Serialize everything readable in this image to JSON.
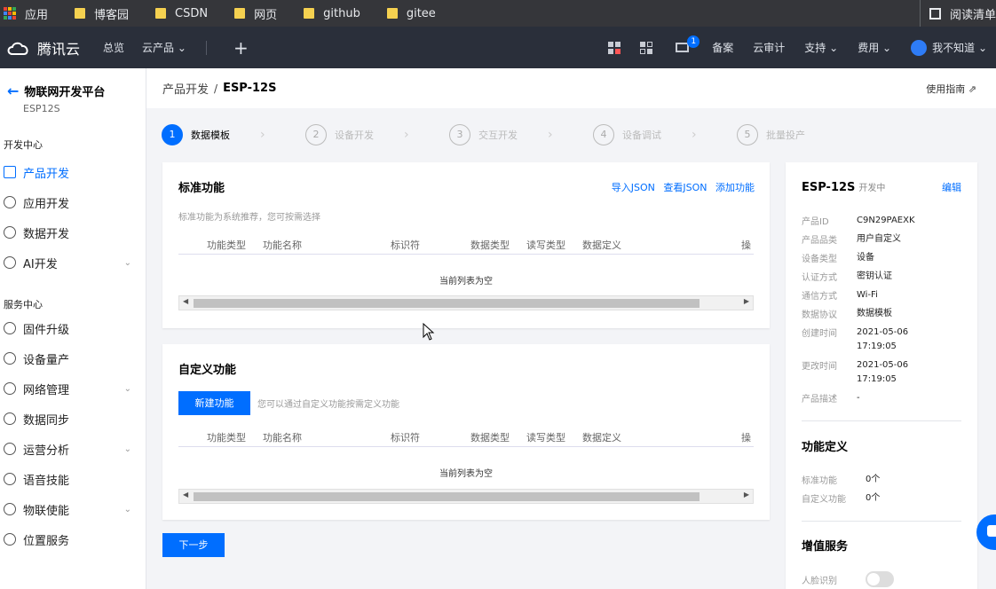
{
  "bookmarks": {
    "apps": "应用",
    "items": [
      "博客园",
      "CSDN",
      "网页",
      "github",
      "gitee"
    ],
    "reading_list": "阅读清单"
  },
  "topnav": {
    "logo": "腾讯云",
    "overview": "总览",
    "products": "云产品",
    "plus": "+",
    "mail_badge": "1",
    "beian": "备案",
    "audit": "云审计",
    "support": "支持",
    "billing": "费用",
    "user": "我不知道"
  },
  "sidebar": {
    "back_title": "物联网开发平台",
    "sub_name": "ESP12S",
    "section_dev": "开发中心",
    "dev_items": [
      {
        "label": "产品开发"
      },
      {
        "label": "应用开发"
      },
      {
        "label": "数据开发"
      },
      {
        "label": "AI开发"
      }
    ],
    "section_service": "服务中心",
    "service_items": [
      {
        "label": "固件升级"
      },
      {
        "label": "设备量产"
      },
      {
        "label": "网络管理"
      },
      {
        "label": "数据同步"
      },
      {
        "label": "运营分析"
      },
      {
        "label": "语音技能"
      },
      {
        "label": "物联使能"
      },
      {
        "label": "位置服务"
      }
    ]
  },
  "breadcrumb": {
    "parent": "产品开发",
    "sep": "/",
    "current": "ESP-12S",
    "guide": "使用指南"
  },
  "steps": [
    {
      "num": "1",
      "label": "数据模板"
    },
    {
      "num": "2",
      "label": "设备开发"
    },
    {
      "num": "3",
      "label": "交互开发"
    },
    {
      "num": "4",
      "label": "设备调试"
    },
    {
      "num": "5",
      "label": "批量投产"
    }
  ],
  "standard": {
    "title": "标准功能",
    "import_json": "导入JSON",
    "view_json": "查看JSON",
    "add": "添加功能",
    "hint": "标准功能为系统推荐，您可按需选择",
    "columns": [
      "功能类型",
      "功能名称",
      "标识符",
      "数据类型",
      "读写类型",
      "数据定义",
      "操"
    ],
    "empty": "当前列表为空"
  },
  "custom": {
    "title": "自定义功能",
    "new_button": "新建功能",
    "hint": "您可以通过自定义功能按需定义功能",
    "columns": [
      "功能类型",
      "功能名称",
      "标识符",
      "数据类型",
      "读写类型",
      "数据定义",
      "操"
    ],
    "empty": "当前列表为空"
  },
  "next_button": "下一步",
  "product": {
    "name": "ESP-12S",
    "status": "开发中",
    "edit": "编辑",
    "fields": [
      {
        "k": "产品ID",
        "v": "C9N29PAEXK"
      },
      {
        "k": "产品品类",
        "v": "用户自定义"
      },
      {
        "k": "设备类型",
        "v": "设备"
      },
      {
        "k": "认证方式",
        "v": "密钥认证"
      },
      {
        "k": "通信方式",
        "v": "Wi-Fi"
      },
      {
        "k": "数据协议",
        "v": "数据模板"
      },
      {
        "k": "创建时间",
        "v": "2021-05-06 17:19:05"
      },
      {
        "k": "更改时间",
        "v": "2021-05-06 17:19:05"
      },
      {
        "k": "产品描述",
        "v": "-"
      }
    ],
    "func_title": "功能定义",
    "std_label": "标准功能",
    "std_count": "0个",
    "custom_label": "自定义功能",
    "custom_count": "0个",
    "value_title": "增值服务",
    "face_label": "人脸识别"
  },
  "colors": {
    "accent": "#006eff",
    "nav_bg": "#2a2f3a",
    "bookmark_bg": "#35363a"
  }
}
